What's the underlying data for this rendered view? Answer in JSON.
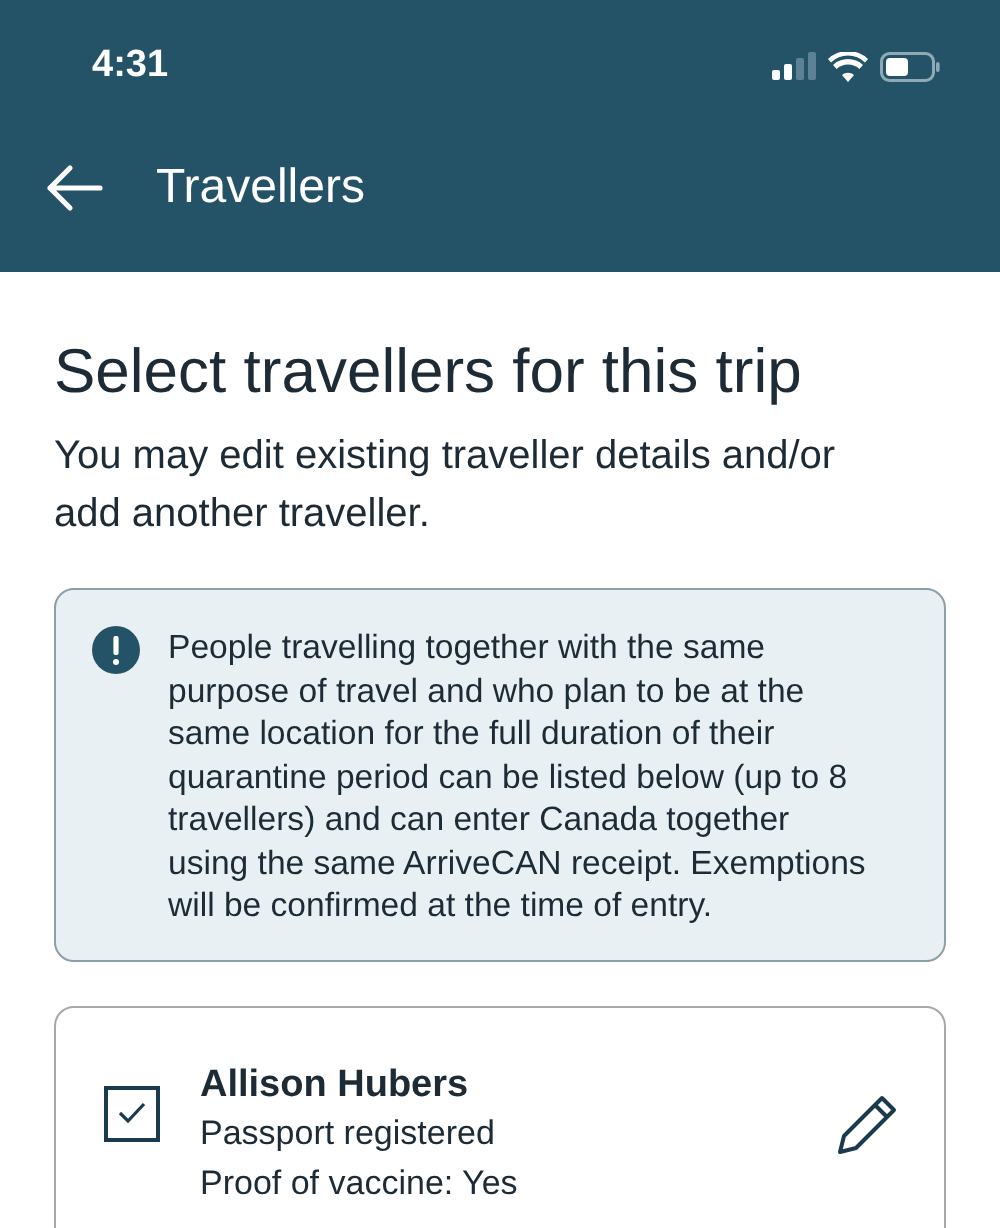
{
  "status_bar": {
    "time": "4:31"
  },
  "header": {
    "title": "Travellers"
  },
  "heading": "Select travellers for this trip",
  "intro": "You may edit existing traveller details and/or add another traveller.",
  "notice": {
    "text": "People travelling together with the same purpose of travel and who plan to be at the same location for the full duration of their quarantine period can be listed below (up to 8 travellers) and can enter Canada together using the same ArriveCAN receipt. Exemptions will be confirmed at the time of entry."
  },
  "travellers": [
    {
      "name": "Allison Hubers",
      "checked": true,
      "details": [
        "Passport registered",
        "Proof of vaccine: Yes"
      ]
    }
  ]
}
